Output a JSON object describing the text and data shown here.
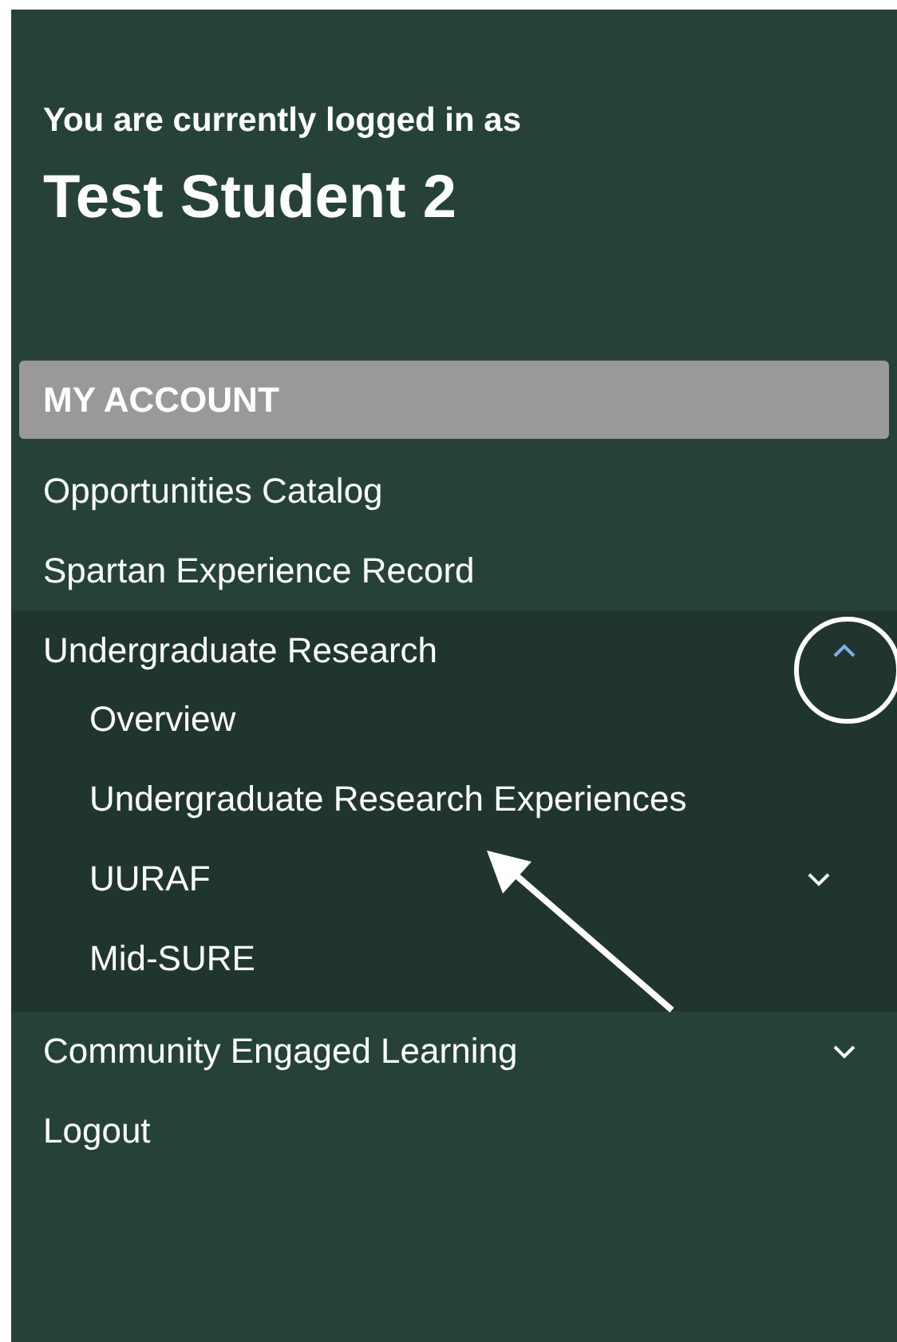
{
  "header": {
    "intro": "You are currently logged in as",
    "user_name": "Test Student 2"
  },
  "section_title": "MY ACCOUNT",
  "menu": [
    {
      "label": "Opportunities Catalog",
      "kind": "link"
    },
    {
      "label": "Spartan Experience Record",
      "kind": "link"
    },
    {
      "label": "Undergraduate Research",
      "kind": "toggle",
      "expanded": true,
      "children": [
        {
          "label": "Overview",
          "kind": "link"
        },
        {
          "label": "Undergraduate Research Experiences",
          "kind": "link"
        },
        {
          "label": "UURAF",
          "kind": "toggle",
          "expanded": false
        },
        {
          "label": "Mid-SURE",
          "kind": "link"
        }
      ]
    },
    {
      "label": "Community Engaged Learning",
      "kind": "toggle",
      "expanded": false
    },
    {
      "label": "Logout",
      "kind": "link"
    }
  ]
}
